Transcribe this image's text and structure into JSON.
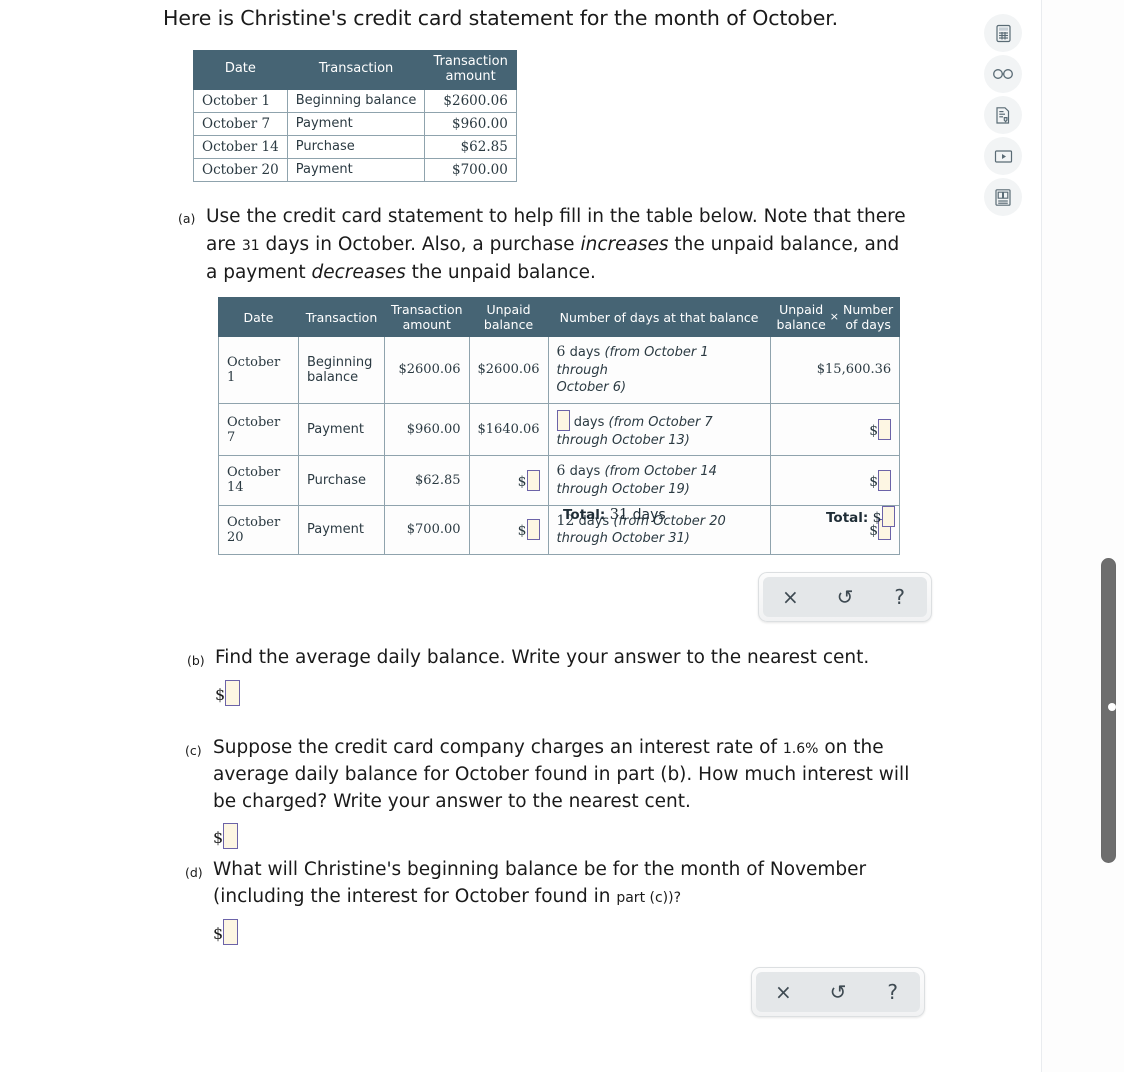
{
  "headline": "Here is Christine's credit card statement for the month of October.",
  "statement_table": {
    "headers": [
      "Date",
      "Transaction",
      "Transaction amount"
    ],
    "header_amount_line1": "Transaction",
    "header_amount_line2": "amount",
    "rows": [
      {
        "date": "October 1",
        "transaction": "Beginning balance",
        "amount": "$2600.06"
      },
      {
        "date": "October 7",
        "transaction": "Payment",
        "amount": "$960.00"
      },
      {
        "date": "October 14",
        "transaction": "Purchase",
        "amount": "$62.85"
      },
      {
        "date": "October 20",
        "transaction": "Payment",
        "amount": "$700.00"
      }
    ]
  },
  "parts": {
    "a": {
      "label": "(a)",
      "text_1": "Use the credit card statement to help fill in the table below. Note that there are ",
      "days_in_month": "31",
      "text_2": " days in October. Also, a purchase ",
      "em_1": "increases",
      "text_3": " the unpaid balance, and a payment ",
      "em_2": "decreases",
      "text_4": " the unpaid balance."
    },
    "b": {
      "label": "(b)",
      "text": "Find the average daily balance. Write your answer to the nearest cent.",
      "answer_prefix": "$",
      "answer_value": ""
    },
    "c": {
      "label": "(c)",
      "text_1": "Suppose the credit card company charges an interest rate of ",
      "rate": "1.6%",
      "text_2": " on the average daily balance for October found in part (b). How much interest will be charged? Write your answer to the nearest cent.",
      "answer_prefix": "$",
      "answer_value": ""
    },
    "d": {
      "label": "(d)",
      "text_1": "What will Christine's beginning balance be for the month of November (including the interest for October found in ",
      "text_small": "part (c))?",
      "answer_prefix": "$",
      "answer_value": ""
    }
  },
  "worksheet_table": {
    "headers": {
      "date": "Date",
      "transaction": "Transaction",
      "transaction_amount_l1": "Transaction",
      "transaction_amount_l2": "amount",
      "unpaid_balance_l1": "Unpaid",
      "unpaid_balance_l2": "balance",
      "days_at_balance": "Number of days at that balance",
      "product_l1": "Unpaid",
      "product_l2": "balance",
      "product_times": "×",
      "product_r1": "Number",
      "product_r2": "of days"
    },
    "rows": [
      {
        "date": "October 1",
        "transaction_l1": "Beginning",
        "transaction_l2": "balance",
        "amount": "$2600.06",
        "unpaid_balance": "$2600.06",
        "unpaid_balance_is_input": false,
        "days_value": "6",
        "days_is_input": false,
        "days_word": "days",
        "days_note_l1": "(from October 1 through",
        "days_note_l2": "October 6)",
        "product": "$15,600.36",
        "product_is_input": false
      },
      {
        "date": "October 7",
        "transaction_l1": "Payment",
        "transaction_l2": "",
        "amount": "$960.00",
        "unpaid_balance": "$1640.06",
        "unpaid_balance_is_input": false,
        "days_value": "",
        "days_is_input": true,
        "days_word": "days",
        "days_note_l1": "(from October 7",
        "days_note_l2": "through October 13)",
        "product": "",
        "product_is_input": true
      },
      {
        "date": "October 14",
        "transaction_l1": "Purchase",
        "transaction_l2": "",
        "amount": "$62.85",
        "unpaid_balance": "",
        "unpaid_balance_is_input": true,
        "days_value": "6",
        "days_is_input": false,
        "days_word": "days",
        "days_note_l1": "(from October 14",
        "days_note_l2": "through October 19)",
        "product": "",
        "product_is_input": true
      },
      {
        "date": "October 20",
        "transaction_l1": "Payment",
        "transaction_l2": "",
        "amount": "$700.00",
        "unpaid_balance": "",
        "unpaid_balance_is_input": true,
        "days_value": "12",
        "days_is_input": false,
        "days_word": "days",
        "days_note_l1": "(from October 20",
        "days_note_l2": "through October 31)",
        "product": "",
        "product_is_input": true
      }
    ],
    "totals": {
      "days_label": "Total:",
      "days_value": "31",
      "days_unit": "days",
      "product_label": "Total:",
      "product_prefix": "$",
      "product_value": ""
    }
  },
  "toolbars": {
    "clear_label": "×",
    "undo_label": "↺",
    "help_label": "?"
  },
  "rail_icons": [
    {
      "name": "calculator-icon"
    },
    {
      "name": "glasses-icon"
    },
    {
      "name": "document-check-icon"
    },
    {
      "name": "video-play-icon"
    },
    {
      "name": "reference-book-icon"
    }
  ],
  "colors": {
    "table_header_bg": "#466474",
    "table_border": "#8fa3ad",
    "input_fill": "#fdf6e3",
    "input_border": "#6c63a8",
    "scrollbar_thumb": "#6e6e6e"
  }
}
